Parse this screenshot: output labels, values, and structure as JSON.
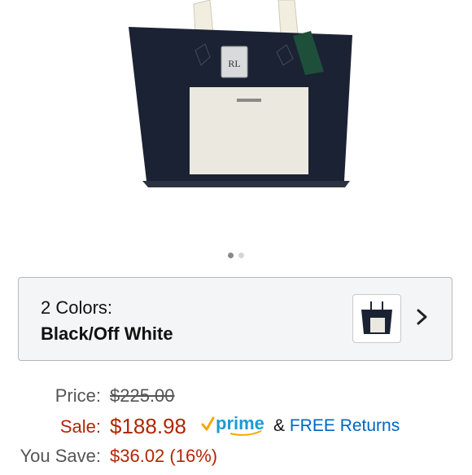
{
  "product_image": {
    "alt": "tote bag",
    "logo_tag_text": "RL",
    "colors": {
      "bag": "#1b2233",
      "pocket": "#ebe8e0",
      "handles": "#f1eedf",
      "tag": "#1e4f3b"
    }
  },
  "carousel": {
    "total": 2,
    "active_index": 0
  },
  "color_selector": {
    "label": "2 Colors:",
    "selected_value": "Black/Off White"
  },
  "pricing": {
    "price_label": "Price:",
    "list_price": "$225.00",
    "sale_label": "Sale:",
    "sale_price": "$188.98",
    "prime_text": "prime",
    "ampersand": "&",
    "returns_text": "FREE Returns",
    "savings_label": "You Save:",
    "savings_value": "$36.02 (16%)"
  },
  "theme": {
    "price_red": "#b12704",
    "link_blue": "#0066c0",
    "prime_blue": "#1c9ad6",
    "prime_orange": "#f7a800"
  }
}
